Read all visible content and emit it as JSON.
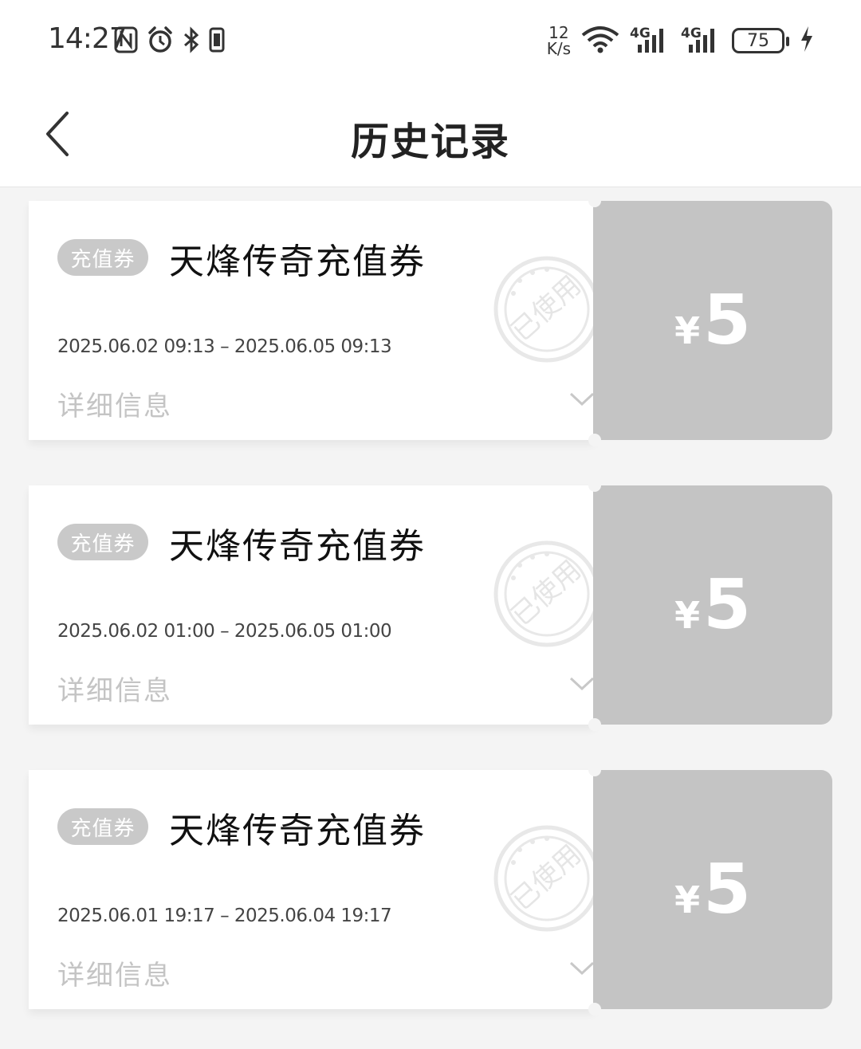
{
  "status_bar": {
    "time": "14:27",
    "net_speed_value": "12",
    "net_speed_unit": "K/s",
    "signal_1_label": "4G",
    "signal_2_label": "4G",
    "battery_level": "75"
  },
  "header": {
    "title": "历史记录"
  },
  "coupons": [
    {
      "tag": "充值券",
      "title": "天烽传奇充值券",
      "validity": "2025.06.02 09:13 – 2025.06.05 09:13",
      "detail_label": "详细信息",
      "stamp_text": "已使用",
      "currency": "¥",
      "amount": "5"
    },
    {
      "tag": "充值券",
      "title": "天烽传奇充值券",
      "validity": "2025.06.02 01:00 – 2025.06.05 01:00",
      "detail_label": "详细信息",
      "stamp_text": "已使用",
      "currency": "¥",
      "amount": "5"
    },
    {
      "tag": "充值券",
      "title": "天烽传奇充值券",
      "validity": "2025.06.01 19:17 – 2025.06.04 19:17",
      "detail_label": "详细信息",
      "stamp_text": "已使用",
      "currency": "¥",
      "amount": "5"
    }
  ],
  "icons": {
    "status_left": [
      "nfc-icon",
      "alarm-icon",
      "bluetooth-icon",
      "vibrate-icon"
    ],
    "status_right": [
      "wifi-icon",
      "cell-signal-icon",
      "cell-signal-icon",
      "battery-icon",
      "charging-icon"
    ],
    "header": [
      "back-arrow-icon"
    ],
    "coupon": [
      "used-stamp-icon",
      "chevron-down-icon"
    ]
  },
  "colors": {
    "accent_gray": "#c4c4c4",
    "tag_gray": "#c9c9c9",
    "background": "#f4f4f4"
  }
}
